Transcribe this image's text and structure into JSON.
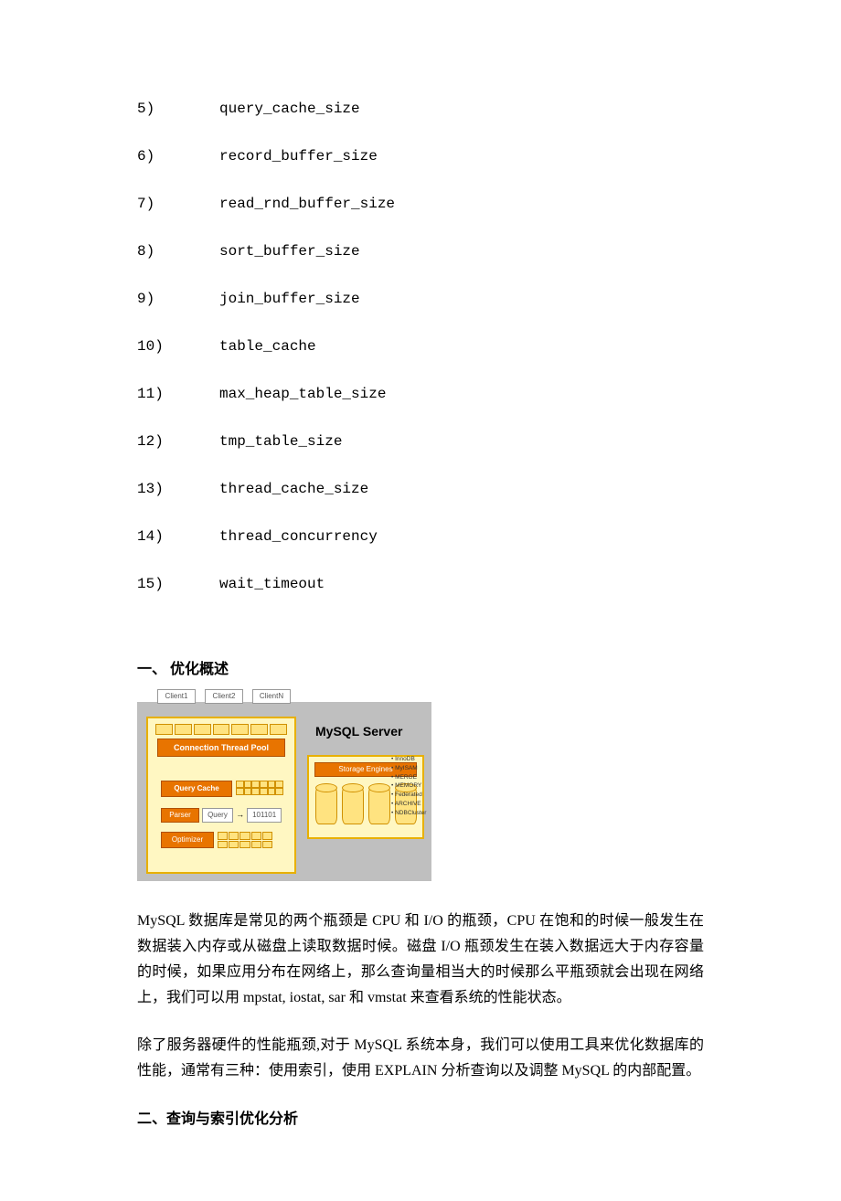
{
  "list": [
    {
      "num": "5)",
      "val": "query_cache_size"
    },
    {
      "num": "6)",
      "val": "record_buffer_size"
    },
    {
      "num": "7)",
      "val": "read_rnd_buffer_size"
    },
    {
      "num": "8)",
      "val": "sort_buffer_size"
    },
    {
      "num": "9)",
      "val": "join_buffer_size"
    },
    {
      "num": "10)",
      "val": "table_cache"
    },
    {
      "num": "11)",
      "val": "max_heap_table_size"
    },
    {
      "num": "12)",
      "val": "tmp_table_size"
    },
    {
      "num": "13)",
      "val": "thread_cache_size"
    },
    {
      "num": "14)",
      "val": "thread_concurrency"
    },
    {
      "num": "15)",
      "val": "wait_timeout"
    }
  ],
  "section1_title": "一、   优化概述",
  "diagram": {
    "clients": [
      "Client1",
      "Client2",
      "ClientN"
    ],
    "connection_pool": "Connection Thread Pool",
    "query_cache": "Query Cache",
    "parser": "Parser",
    "query": "Query",
    "query_code": "101101",
    "optimizer": "Optimizer",
    "server_label": "MySQL Server",
    "storage_engines": "Storage Engines",
    "engines": [
      "InnoDB",
      "MyISAM",
      "MERGE",
      "MEMORY",
      "Federated",
      "ARCHIVE",
      "NDBCluster"
    ]
  },
  "para1": "MySQL 数据库是常见的两个瓶颈是 CPU 和 I/O 的瓶颈，CPU 在饱和的时候一般发生在数据装入内存或从磁盘上读取数据时候。磁盘 I/O 瓶颈发生在装入数据远大于内存容量的时候，如果应用分布在网络上，那么查询量相当大的时候那么平瓶颈就会出现在网络上，我们可以用 mpstat, iostat, sar 和 vmstat 来查看系统的性能状态。",
  "para2": "除了服务器硬件的性能瓶颈,对于 MySQL 系统本身，我们可以使用工具来优化数据库的性能，通常有三种：使用索引，使用 EXPLAIN 分析查询以及调整 MySQL 的内部配置。",
  "section2_title": "二、查询与索引优化分析"
}
